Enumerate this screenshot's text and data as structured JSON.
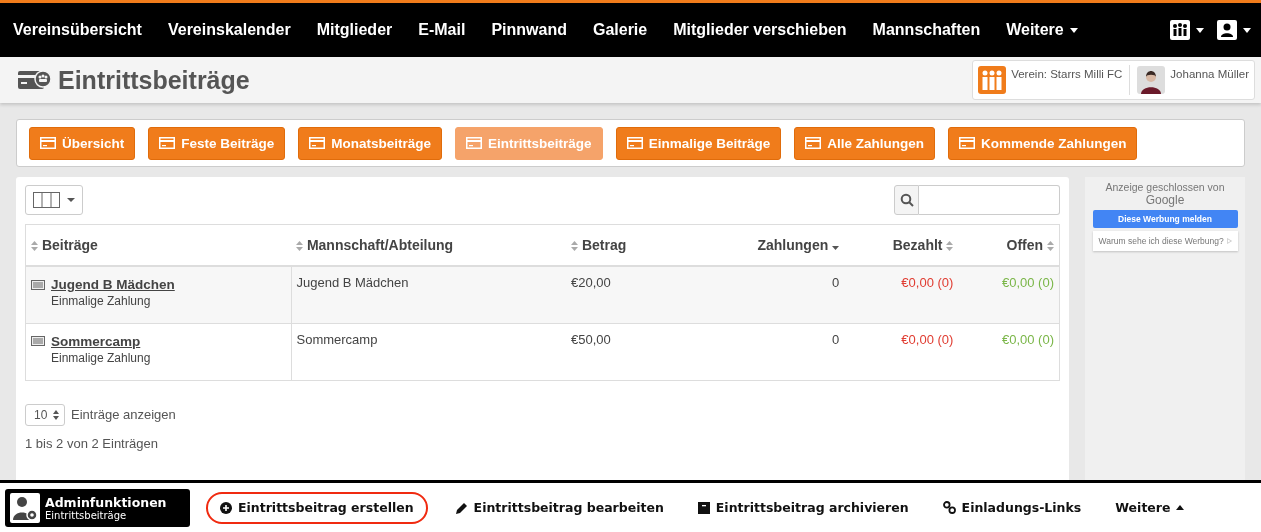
{
  "nav": {
    "items": [
      {
        "label": "Vereinsübersicht",
        "kind": "link"
      },
      {
        "label": "Vereinskalender",
        "kind": "link"
      },
      {
        "label": "Mitglieder",
        "kind": "link"
      },
      {
        "label": "E-Mail",
        "kind": "link"
      },
      {
        "label": "Pinnwand",
        "kind": "link"
      },
      {
        "label": "Galerie",
        "kind": "link"
      },
      {
        "label": "Mitglieder verschieben",
        "kind": "link"
      },
      {
        "label": "Mannschaften",
        "kind": "link"
      },
      {
        "label": "Weitere",
        "kind": "dropdown"
      }
    ]
  },
  "header": {
    "title": "Eintrittsbeiträge",
    "club": "Verein: Starrs Milli FC",
    "user": "Johanna Müller"
  },
  "tabs": [
    {
      "label": "Übersicht",
      "selected": false
    },
    {
      "label": "Feste Beiträge",
      "selected": false
    },
    {
      "label": "Monatsbeiträge",
      "selected": false
    },
    {
      "label": "Eintrittsbeiträge",
      "selected": true
    },
    {
      "label": "Einmalige Beiträge",
      "selected": false
    },
    {
      "label": "Alle Zahlungen",
      "selected": false
    },
    {
      "label": "Kommende Zahlungen",
      "selected": false
    }
  ],
  "table": {
    "columns": [
      {
        "label": "Beiträge",
        "sorted": false
      },
      {
        "label": "Mannschaft/Abteilung",
        "sorted": false
      },
      {
        "label": "Betrag",
        "sorted": false
      },
      {
        "label": "Zahlungen",
        "sorted": true
      },
      {
        "label": "Bezahlt",
        "sorted": false
      },
      {
        "label": "Offen",
        "sorted": false
      }
    ],
    "rows": [
      {
        "title": "Jugend B Mädchen",
        "subtitle": "Einmalige Zahlung",
        "team": "Jugend B Mädchen",
        "amount": "€20,00",
        "payments": "0",
        "paid": "€0,00 (0)",
        "open": "€0,00 (0)"
      },
      {
        "title": "Sommercamp",
        "subtitle": "Einmalige Zahlung",
        "team": "Sommercamp",
        "amount": "€50,00",
        "payments": "0",
        "paid": "€0,00 (0)",
        "open": "€0,00 (0)"
      }
    ],
    "page_length": "10",
    "page_length_label": "Einträge anzeigen",
    "info": "1 bis 2 von 2 Einträgen"
  },
  "ad": {
    "notice": "Anzeige geschlossen von",
    "brand": "Google",
    "report": "Diese Werbung melden",
    "why": "Warum sehe ich diese Werbung?"
  },
  "admin_bar": {
    "title": "Adminfunktionen",
    "subtitle": "Eintrittsbeiträge",
    "actions": [
      {
        "label": "Eintrittsbeitrag erstellen",
        "kind": "create",
        "highlighted": true
      },
      {
        "label": "Eintrittsbeitrag bearbeiten",
        "kind": "edit",
        "highlighted": false
      },
      {
        "label": "Eintrittsbeitrag archivieren",
        "kind": "archive",
        "highlighted": false
      },
      {
        "label": "Einladungs-Links",
        "kind": "link",
        "highlighted": false
      },
      {
        "label": "Weitere",
        "kind": "more",
        "highlighted": false
      }
    ]
  }
}
